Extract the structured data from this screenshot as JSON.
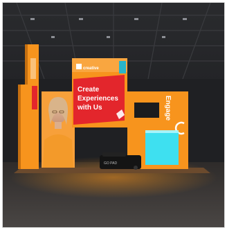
{
  "scene": {
    "banner": {
      "line1": "Create",
      "line2": "Experiences",
      "line3": "with Us"
    },
    "brand_name": "creative",
    "side_word": "Engage",
    "case_label": "GO PAD",
    "colors": {
      "accent_orange": "#f7941d",
      "banner_red": "#e3262c",
      "teal_panel": "#2ab5c9",
      "cyan_counter": "#3ee0f0",
      "floor": "#3a3634"
    }
  }
}
